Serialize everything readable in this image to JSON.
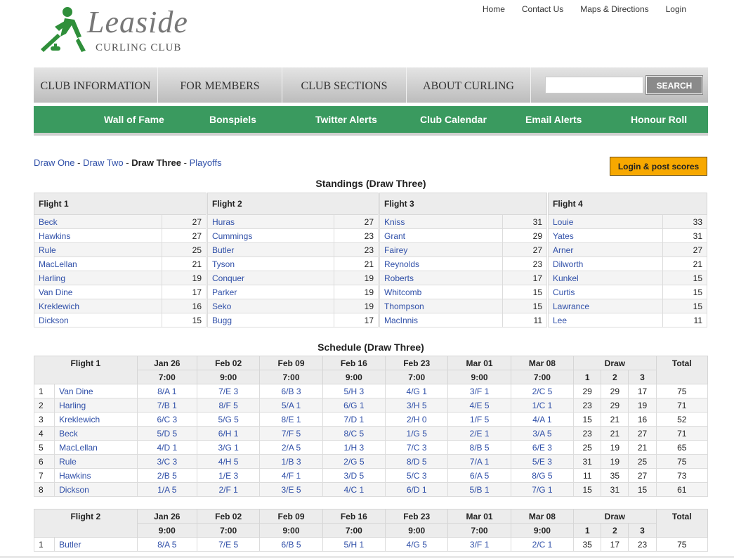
{
  "logo": {
    "script": "Leaside",
    "subtitle": "CURLING CLUB"
  },
  "toplinks": [
    "Home",
    "Contact Us",
    "Maps & Directions",
    "Login"
  ],
  "mainnav": [
    "CLUB INFORMATION",
    "FOR MEMBERS",
    "CLUB SECTIONS",
    "ABOUT CURLING"
  ],
  "search": {
    "button": "SEARCH",
    "placeholder": ""
  },
  "subnav": [
    "Wall of Fame",
    "Bonspiels",
    "Twitter Alerts",
    "Club Calendar",
    "Email Alerts",
    "Honour Roll"
  ],
  "draws": {
    "one": "Draw One",
    "two": "Draw Two",
    "three": "Draw Three",
    "playoffs": "Playoffs",
    "sep": " - "
  },
  "login_button": "Login & post scores",
  "standings_title": "Standings (Draw Three)",
  "standings": [
    {
      "flight": "Flight 1",
      "teams": [
        [
          "Beck",
          "27"
        ],
        [
          "Hawkins",
          "27"
        ],
        [
          "Rule",
          "25"
        ],
        [
          "MacLellan",
          "21"
        ],
        [
          "Harling",
          "19"
        ],
        [
          "Van Dine",
          "17"
        ],
        [
          "Kreklewich",
          "16"
        ],
        [
          "Dickson",
          "15"
        ]
      ]
    },
    {
      "flight": "Flight 2",
      "teams": [
        [
          "Huras",
          "27"
        ],
        [
          "Cummings",
          "23"
        ],
        [
          "Butler",
          "23"
        ],
        [
          "Tyson",
          "21"
        ],
        [
          "Conquer",
          "19"
        ],
        [
          "Parker",
          "19"
        ],
        [
          "Seko",
          "19"
        ],
        [
          "Bugg",
          "17"
        ]
      ]
    },
    {
      "flight": "Flight 3",
      "teams": [
        [
          "Kniss",
          "31"
        ],
        [
          "Grant",
          "29"
        ],
        [
          "Fairey",
          "27"
        ],
        [
          "Reynolds",
          "23"
        ],
        [
          "Roberts",
          "17"
        ],
        [
          "Whitcomb",
          "15"
        ],
        [
          "Thompson",
          "15"
        ],
        [
          "MacInnis",
          "11"
        ]
      ]
    },
    {
      "flight": "Flight 4",
      "teams": [
        [
          "Louie",
          "33"
        ],
        [
          "Yates",
          "31"
        ],
        [
          "Arner",
          "27"
        ],
        [
          "Dilworth",
          "21"
        ],
        [
          "Kunkel",
          "15"
        ],
        [
          "Curtis",
          "15"
        ],
        [
          "Lawrance",
          "15"
        ],
        [
          "Lee",
          "11"
        ]
      ]
    }
  ],
  "schedule_title": "Schedule (Draw Three)",
  "schedule": [
    {
      "flight": "Flight 1",
      "dates": [
        "Jan 26",
        "Feb 02",
        "Feb 09",
        "Feb 16",
        "Feb 23",
        "Mar 01",
        "Mar 08"
      ],
      "times": [
        "7:00",
        "9:00",
        "7:00",
        "9:00",
        "7:00",
        "9:00",
        "7:00"
      ],
      "draw_label": "Draw",
      "draw_cols": [
        "1",
        "2",
        "3"
      ],
      "total_label": "Total",
      "rows": [
        [
          "1",
          "Van Dine",
          "8/A 1",
          "7/E 3",
          "6/B 3",
          "5/H 3",
          "4/G 1",
          "3/F 1",
          "2/C 5",
          "29",
          "29",
          "17",
          "75"
        ],
        [
          "2",
          "Harling",
          "7/B 1",
          "8/F 5",
          "5/A 1",
          "6/G 1",
          "3/H 5",
          "4/E 5",
          "1/C 1",
          "23",
          "29",
          "19",
          "71"
        ],
        [
          "3",
          "Kreklewich",
          "6/C 3",
          "5/G 5",
          "8/E 1",
          "7/D 1",
          "2/H 0",
          "1/F 5",
          "4/A 1",
          "15",
          "21",
          "16",
          "52"
        ],
        [
          "4",
          "Beck",
          "5/D 5",
          "6/H 1",
          "7/F 5",
          "8/C 5",
          "1/G 5",
          "2/E 1",
          "3/A 5",
          "23",
          "21",
          "27",
          "71"
        ],
        [
          "5",
          "MacLellan",
          "4/D 1",
          "3/G 1",
          "2/A 5",
          "1/H 3",
          "7/C 3",
          "8/B 5",
          "6/E 3",
          "25",
          "19",
          "21",
          "65"
        ],
        [
          "6",
          "Rule",
          "3/C 3",
          "4/H 5",
          "1/B 3",
          "2/G 5",
          "8/D 5",
          "7/A 1",
          "5/E 3",
          "31",
          "19",
          "25",
          "75"
        ],
        [
          "7",
          "Hawkins",
          "2/B 5",
          "1/E 3",
          "4/F 1",
          "3/D 5",
          "5/C 3",
          "6/A 5",
          "8/G 5",
          "11",
          "35",
          "27",
          "73"
        ],
        [
          "8",
          "Dickson",
          "1/A 5",
          "2/F 1",
          "3/E 5",
          "4/C 1",
          "6/D 1",
          "5/B 1",
          "7/G 1",
          "15",
          "31",
          "15",
          "61"
        ]
      ]
    },
    {
      "flight": "Flight 2",
      "dates": [
        "Jan 26",
        "Feb 02",
        "Feb 09",
        "Feb 16",
        "Feb 23",
        "Mar 01",
        "Mar 08"
      ],
      "times": [
        "9:00",
        "7:00",
        "9:00",
        "7:00",
        "9:00",
        "7:00",
        "9:00"
      ],
      "draw_label": "Draw",
      "draw_cols": [
        "1",
        "2",
        "3"
      ],
      "total_label": "Total",
      "rows": [
        [
          "1",
          "Butler",
          "8/A 5",
          "7/E 5",
          "6/B 5",
          "5/H 1",
          "4/G 5",
          "3/F 1",
          "2/C 1",
          "35",
          "17",
          "23",
          "75"
        ]
      ]
    }
  ]
}
